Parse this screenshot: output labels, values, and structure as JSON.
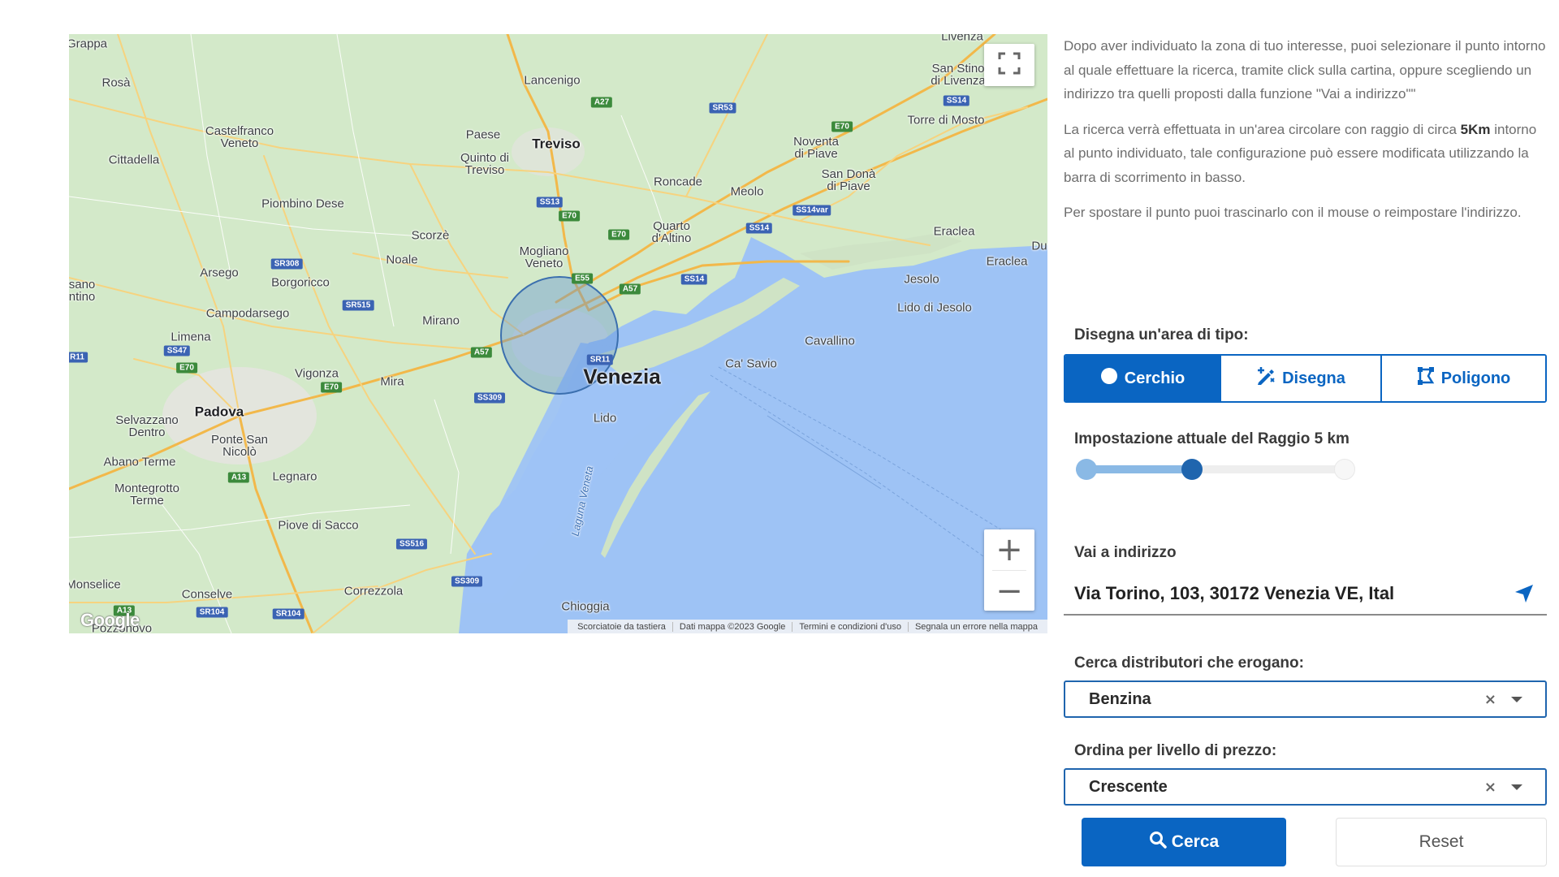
{
  "map": {
    "cities": [
      {
        "name": "Grappa",
        "big": false
      },
      {
        "name": "Rosà",
        "big": false
      },
      {
        "name": "Lancenigo",
        "big": false
      },
      {
        "name": "Castelfranco\nVeneto",
        "big": false
      },
      {
        "name": "Paese",
        "big": false
      },
      {
        "name": "Treviso",
        "big": true
      },
      {
        "name": "Quinto di\nTreviso",
        "big": false
      },
      {
        "name": "Cittadella",
        "big": false
      },
      {
        "name": "Noventa\ndi Piave",
        "big": false
      },
      {
        "name": "San Donà\ndi Piave",
        "big": false
      },
      {
        "name": "Roncade",
        "big": false
      },
      {
        "name": "Meolo",
        "big": false
      },
      {
        "name": "Piombino Dese",
        "big": false
      },
      {
        "name": "Quarto\nd'Altino",
        "big": false
      },
      {
        "name": "Scorzè",
        "big": false
      },
      {
        "name": "Torre di Mosto",
        "big": false
      },
      {
        "name": "San Stino\ndi Livenza",
        "big": false
      },
      {
        "name": "Eraclea",
        "big": false
      },
      {
        "name": "Eraclea",
        "big": false
      },
      {
        "name": "Mogliano\nVeneto",
        "big": false
      },
      {
        "name": "Noale",
        "big": false
      },
      {
        "name": "Arsego",
        "big": false
      },
      {
        "name": "Borgoricco",
        "big": false
      },
      {
        "name": "Jesolo",
        "big": false
      },
      {
        "name": "Lido di Jesolo",
        "big": false
      },
      {
        "name": "sano\nntino",
        "big": false
      },
      {
        "name": "Campodarsego",
        "big": false
      },
      {
        "name": "Mirano",
        "big": false
      },
      {
        "name": "Limena",
        "big": false
      },
      {
        "name": "Cavallino",
        "big": false
      },
      {
        "name": "Vigonza",
        "big": false
      },
      {
        "name": "Ca' Savio",
        "big": false
      },
      {
        "name": "Mira",
        "big": false
      },
      {
        "name": "Padova",
        "big": true
      },
      {
        "name": "Selvazzano\nDentro",
        "big": false
      },
      {
        "name": "Lido",
        "big": false
      },
      {
        "name": "Ponte San\nNicolò",
        "big": false
      },
      {
        "name": "Abano Terme",
        "big": false
      },
      {
        "name": "Legnaro",
        "big": false
      },
      {
        "name": "Montegrotto\nTerme",
        "big": false
      },
      {
        "name": "Piove di Sacco",
        "big": false
      },
      {
        "name": "Monselice",
        "big": false
      },
      {
        "name": "Conselve",
        "big": false
      },
      {
        "name": "Correzzola",
        "big": false
      },
      {
        "name": "Chioggia",
        "big": false
      },
      {
        "name": "Pozzonovo",
        "big": false
      },
      {
        "name": "Du",
        "big": false
      },
      {
        "name": "Livenza",
        "big": false
      }
    ],
    "main_city": "Venezia",
    "lagoon_label": "Laguna Veneta",
    "shields": [
      {
        "code": "A27",
        "color": "green"
      },
      {
        "code": "SR53",
        "color": "blue"
      },
      {
        "code": "E70",
        "color": "green"
      },
      {
        "code": "SS14",
        "color": "blue"
      },
      {
        "code": "SS13",
        "color": "blue"
      },
      {
        "code": "E70",
        "color": "green"
      },
      {
        "code": "E70",
        "color": "green"
      },
      {
        "code": "SS14",
        "color": "blue"
      },
      {
        "code": "SS14var",
        "color": "blue"
      },
      {
        "code": "SR308",
        "color": "blue"
      },
      {
        "code": "E55",
        "color": "green"
      },
      {
        "code": "SS14",
        "color": "blue"
      },
      {
        "code": "A57",
        "color": "green"
      },
      {
        "code": "SR515",
        "color": "blue"
      },
      {
        "code": "SS47",
        "color": "blue"
      },
      {
        "code": "R11",
        "color": "blue"
      },
      {
        "code": "A57",
        "color": "green"
      },
      {
        "code": "SR11",
        "color": "blue"
      },
      {
        "code": "E70",
        "color": "green"
      },
      {
        "code": "E70",
        "color": "green"
      },
      {
        "code": "SS309",
        "color": "blue"
      },
      {
        "code": "A13",
        "color": "green"
      },
      {
        "code": "SS516",
        "color": "blue"
      },
      {
        "code": "SS309",
        "color": "blue"
      },
      {
        "code": "A13",
        "color": "green"
      },
      {
        "code": "SR104",
        "color": "blue"
      },
      {
        "code": "SR104",
        "color": "blue"
      }
    ],
    "footer": [
      "Scorciatoie da tastiera",
      "Dati mappa ©2023 Google",
      "Termini e condizioni d'uso",
      "Segnala un errore nella mappa"
    ],
    "logo": "Google",
    "zoom_in": "+",
    "zoom_out": "−"
  },
  "panel": {
    "info1": "Dopo aver individuato la zona di tuo interesse, puoi selezionare il punto intorno al quale effettuare la ricerca, tramite click sulla cartina, oppure scegliendo un indirizzo tra quelli proposti dalla funzione \"Vai a indirizzo\"\"",
    "info2_a": "La ricerca verrà effettuata in un'area circolare con raggio di circa ",
    "info2_bold": "5Km",
    "info2_b": " intorno al punto individuato, tale configurazione può essere modificata utilizzando la barra di scorrimento in basso.",
    "info3": "Per spostare il punto puoi trascinarlo con il mouse o reimpostare l'indirizzo.",
    "draw_label": "Disegna un'area di tipo:",
    "shapes": [
      {
        "label": "Cerchio",
        "icon": "circle-icon",
        "active": true
      },
      {
        "label": "Disegna",
        "icon": "draw-icon",
        "active": false
      },
      {
        "label": "Poligono",
        "icon": "polygon-icon",
        "active": false
      }
    ],
    "radius_label": "Impostazione attuale del Raggio 5 km",
    "radius_fraction": 0.41,
    "address_label": "Vai a indirizzo",
    "address_value": "Via Torino, 103, 30172 Venezia VE, Ital",
    "fuel_label": "Cerca distributori che erogano:",
    "fuel_value": "Benzina",
    "order_label": "Ordina per livello di prezzo:",
    "order_value": "Crescente",
    "clear_symbol": "×",
    "search_label": "Cerca",
    "reset_label": "Reset"
  },
  "colors": {
    "accent": "#0a65c2",
    "water": "#9ec3f5",
    "land": "#cfe8c6",
    "radius_circle": "#5a8fd6"
  }
}
